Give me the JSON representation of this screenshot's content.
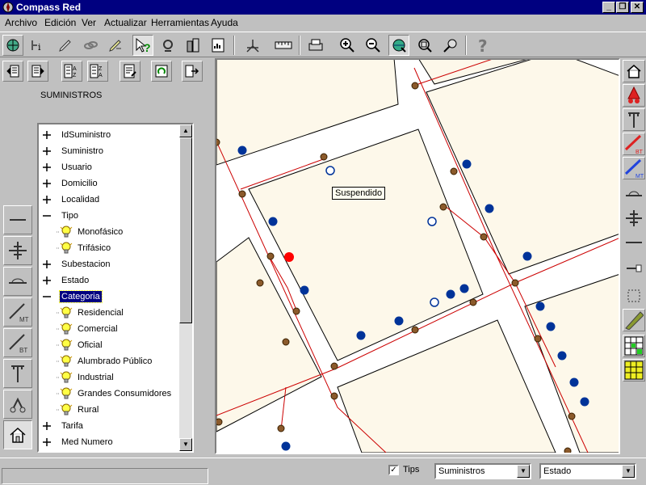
{
  "window": {
    "title": "Compass Red"
  },
  "menu": [
    "Archivo",
    "Edición",
    "Ver",
    "Actualizar",
    "Herramientas",
    "Ayuda"
  ],
  "panel": {
    "title": "SUMINISTROS"
  },
  "tree": {
    "items": [
      {
        "label": "IdSuministro",
        "expand": "plus",
        "level": 0
      },
      {
        "label": "Suministro",
        "expand": "plus",
        "level": 0
      },
      {
        "label": "Usuario",
        "expand": "plus",
        "level": 0
      },
      {
        "label": "Domicilio",
        "expand": "plus",
        "level": 0
      },
      {
        "label": "Localidad",
        "expand": "plus",
        "level": 0
      },
      {
        "label": "Tipo",
        "expand": "minus",
        "level": 0
      },
      {
        "label": "Monofásico",
        "expand": "bulb",
        "level": 1
      },
      {
        "label": "Trifásico",
        "expand": "bulb",
        "level": 1
      },
      {
        "label": "Subestacion",
        "expand": "plus",
        "level": 0
      },
      {
        "label": "Estado",
        "expand": "plus",
        "level": 0
      },
      {
        "label": "Categoria",
        "expand": "minus",
        "level": 0,
        "selected": true
      },
      {
        "label": "Residencial",
        "expand": "bulb",
        "level": 1
      },
      {
        "label": "Comercial",
        "expand": "bulb",
        "level": 1
      },
      {
        "label": "Oficial",
        "expand": "bulb",
        "level": 1
      },
      {
        "label": "Alumbrado Público",
        "expand": "bulb",
        "level": 1
      },
      {
        "label": "Industrial",
        "expand": "bulb",
        "level": 1
      },
      {
        "label": "Grandes Consumidores",
        "expand": "bulb",
        "level": 1
      },
      {
        "label": "Rural",
        "expand": "bulb",
        "level": 1
      },
      {
        "label": "Tarifa",
        "expand": "plus",
        "level": 0
      },
      {
        "label": "Med Numero",
        "expand": "plus",
        "level": 0
      }
    ]
  },
  "map": {
    "tooltip": "Suspendido"
  },
  "icons": {
    "toolbar": [
      "globe-icon",
      "info-icon",
      "pencil-icon",
      "link-icon",
      "edit-icon",
      "help-cursor-icon",
      "spiral-icon",
      "building-icon",
      "report-icon",
      "tripod-icon",
      "ruler-icon",
      "print-icon",
      "zoom-in-icon",
      "zoom-out-icon",
      "globe-arrows-icon",
      "zoom-extent-icon",
      "pan-icon",
      "help-icon"
    ],
    "tree_toolbar": [
      "list-left-icon",
      "list-right-icon",
      "sort-az-icon",
      "sort-za-icon",
      "properties-icon",
      "refresh-icon",
      "export-icon"
    ],
    "left_tools": [
      "line-icon",
      "cross-icon",
      "cable-icon",
      "mt-line-icon",
      "bt-line-icon",
      "pole-icon",
      "vehicle-icon",
      "home-icon"
    ],
    "right_tools": [
      "home-icon",
      "transformer-icon",
      "pole-icon",
      "bt-line-icon",
      "mt-line-icon",
      "cable-icon",
      "cross-icon",
      "line-icon",
      "meter-icon",
      "select-icon",
      "road-icon",
      "grid-green-icon",
      "grid-yellow-icon"
    ]
  },
  "statusbar": {
    "tips_label": "Tips",
    "tips_checked": "✓",
    "layer_combo": "Suministros",
    "field_combo": "Estado"
  }
}
